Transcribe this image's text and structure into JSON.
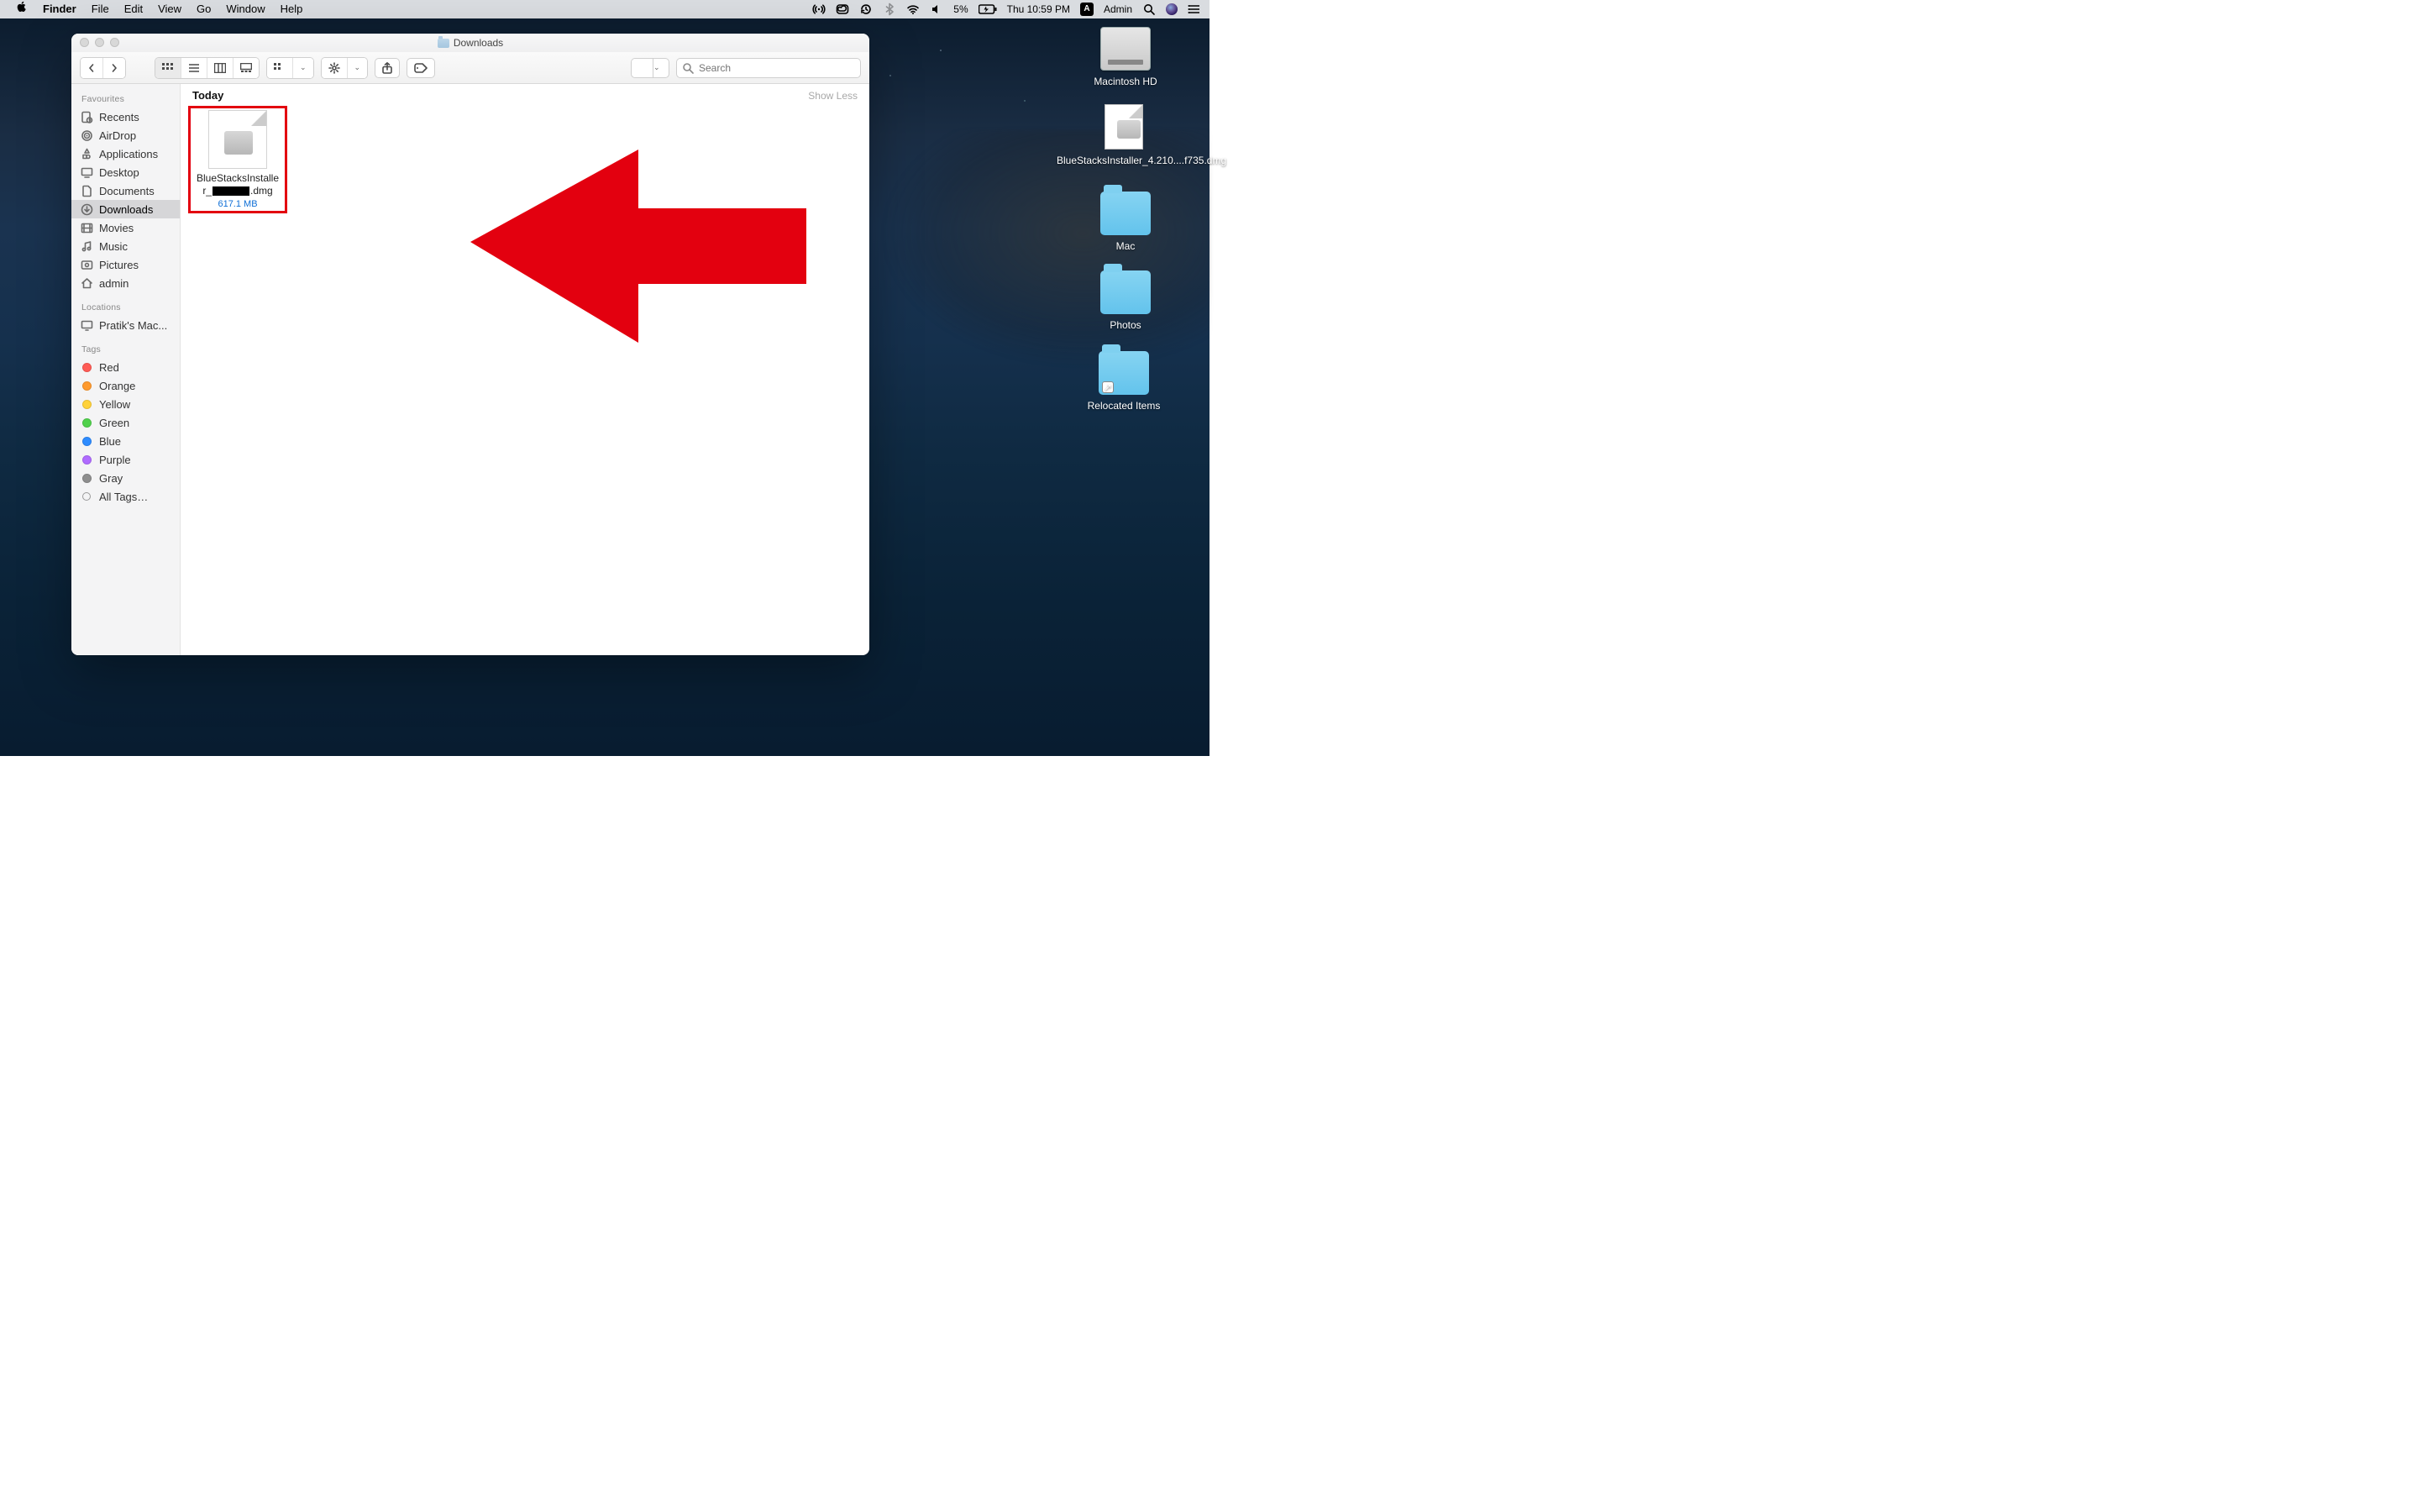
{
  "menubar": {
    "app": "Finder",
    "items": [
      "File",
      "Edit",
      "View",
      "Go",
      "Window",
      "Help"
    ],
    "battery_pct": "5%",
    "datetime": "Thu 10:59 PM",
    "user": "Admin",
    "badge": "A"
  },
  "desktop_icons": {
    "hd": "Macintosh HD",
    "dmg": "BlueStacksInstaller_4.210....f735.dmg",
    "folders": [
      "Mac",
      "Photos",
      "Relocated Items"
    ]
  },
  "finder": {
    "title": "Downloads",
    "search_placeholder": "Search",
    "sidebar": {
      "favourites_head": "Favourites",
      "favourites": [
        "Recents",
        "AirDrop",
        "Applications",
        "Desktop",
        "Documents",
        "Downloads",
        "Movies",
        "Music",
        "Pictures",
        "admin"
      ],
      "selected": "Downloads",
      "locations_head": "Locations",
      "locations": [
        "Pratik's Mac..."
      ],
      "tags_head": "Tags",
      "tags": [
        {
          "name": "Red",
          "color": "#ff5b55"
        },
        {
          "name": "Orange",
          "color": "#ff9a2e"
        },
        {
          "name": "Yellow",
          "color": "#ffd23a"
        },
        {
          "name": "Green",
          "color": "#50d14c"
        },
        {
          "name": "Blue",
          "color": "#2e8cff"
        },
        {
          "name": "Purple",
          "color": "#b06bff"
        },
        {
          "name": "Gray",
          "color": "#8e8e8e"
        }
      ],
      "all_tags": "All Tags…"
    },
    "group_title": "Today",
    "show_less": "Show Less",
    "file": {
      "name_line1": "BlueStacksInstalle",
      "name_prefix": "r_",
      "name_suffix": ".dmg",
      "size": "617.1 MB"
    }
  }
}
